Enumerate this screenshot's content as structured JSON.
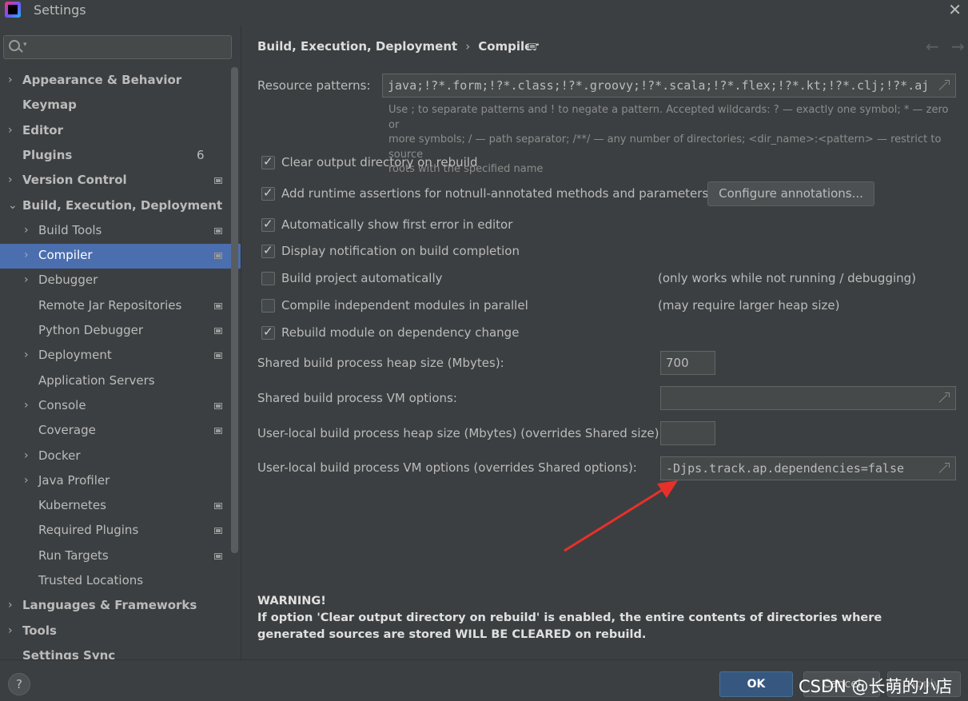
{
  "window": {
    "title": "Settings"
  },
  "sidebar": {
    "search_placeholder": "",
    "items": [
      {
        "label": "Appearance & Behavior",
        "arrow": "›",
        "bold": true
      },
      {
        "label": "Keymap",
        "bold": true
      },
      {
        "label": "Editor",
        "arrow": "›",
        "bold": true
      },
      {
        "label": "Plugins",
        "bold": true,
        "count": "6"
      },
      {
        "label": "Version Control",
        "arrow": "›",
        "bold": true,
        "proj": true
      },
      {
        "label": "Build, Execution, Deployment",
        "arrow": "⌄",
        "bold": true
      },
      {
        "label": "Build Tools",
        "arrow": "›",
        "proj": true
      },
      {
        "label": "Compiler",
        "arrow": "›",
        "proj": true,
        "selected": true
      },
      {
        "label": "Debugger",
        "arrow": "›"
      },
      {
        "label": "Remote Jar Repositories",
        "proj": true
      },
      {
        "label": "Python Debugger",
        "proj": true
      },
      {
        "label": "Deployment",
        "arrow": "›",
        "proj": true
      },
      {
        "label": "Application Servers"
      },
      {
        "label": "Console",
        "arrow": "›",
        "proj": true
      },
      {
        "label": "Coverage",
        "proj": true
      },
      {
        "label": "Docker",
        "arrow": "›"
      },
      {
        "label": "Java Profiler",
        "arrow": "›"
      },
      {
        "label": "Kubernetes",
        "proj": true
      },
      {
        "label": "Required Plugins",
        "proj": true
      },
      {
        "label": "Run Targets",
        "proj": true
      },
      {
        "label": "Trusted Locations"
      },
      {
        "label": "Languages & Frameworks",
        "arrow": "›",
        "bold": true
      },
      {
        "label": "Tools",
        "arrow": "›",
        "bold": true
      },
      {
        "label": "Settings Sync",
        "bold": true
      }
    ]
  },
  "breadcrumb": {
    "parent": "Build, Execution, Deployment",
    "sep": "›",
    "current": "Compiler"
  },
  "compiler": {
    "resource_patterns_label": "Resource patterns:",
    "resource_patterns_value": "java;!?*.form;!?*.class;!?*.groovy;!?*.scala;!?*.flex;!?*.kt;!?*.clj;!?*.aj",
    "hint_line1": "Use ; to separate patterns and ! to negate a pattern. Accepted wildcards: ? — exactly one symbol; * — zero or",
    "hint_line2": "more symbols; / — path separator; /**/ — any number of directories; <dir_name>:<pattern> — restrict to source",
    "hint_line3": "roots with the specified name",
    "clear_output": "Clear output directory on rebuild",
    "add_assertions": "Add runtime assertions for notnull-annotated methods and parameters",
    "configure_annotations": "Configure annotations...",
    "show_first_error": "Automatically show first error in editor",
    "display_notification": "Display notification on build completion",
    "build_auto": "Build project automatically",
    "build_auto_note": "(only works while not running / debugging)",
    "compile_parallel": "Compile independent modules in parallel",
    "compile_parallel_note": "(may require larger heap size)",
    "rebuild_on_dep": "Rebuild module on dependency change",
    "heap_label": "Shared build process heap size (Mbytes):",
    "heap_value": "700",
    "vm_label": "Shared build process VM options:",
    "vm_value": "",
    "user_heap_label": "User-local build process heap size (Mbytes) (overrides Shared size):",
    "user_heap_value": "",
    "user_vm_label": "User-local build process VM options (overrides Shared options):",
    "user_vm_value": "-Djps.track.ap.dependencies=false",
    "warning_title": "WARNING!",
    "warning_text": "If option 'Clear output directory on rebuild' is enabled, the entire contents of directories where generated sources are stored WILL BE CLEARED on rebuild."
  },
  "footer": {
    "help": "?",
    "ok": "OK",
    "cancel": "Cancel",
    "apply": "Apply",
    "watermark": "CSDN @长萌的小店"
  },
  "colors": {
    "accent": "#4b6eaf",
    "ok": "#365880",
    "annotation_arrow": "#e8302a"
  }
}
